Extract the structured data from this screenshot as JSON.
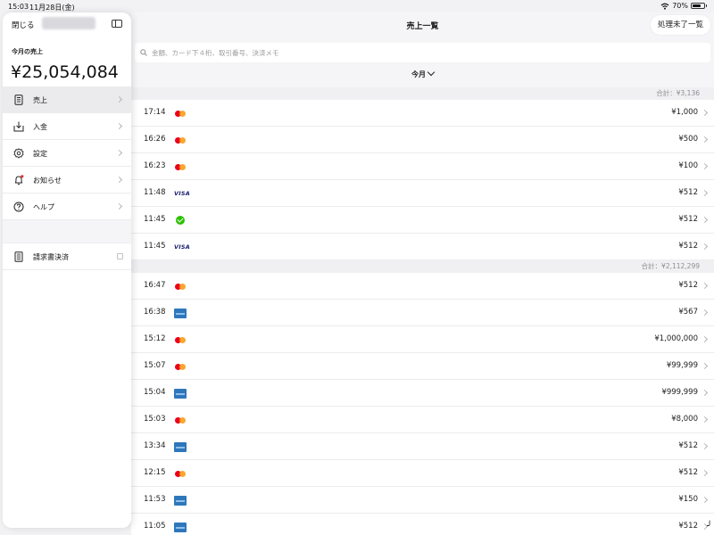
{
  "status_bar": {
    "time": "15:03",
    "date": "11月28日(金)",
    "battery": "70%",
    "battery_level": 0.7
  },
  "sidebar": {
    "close_label": "閉じる",
    "sales_label": "今月の売上",
    "sales_total": "¥25,054,084",
    "items": [
      {
        "label": "売上",
        "icon": "receipt-icon",
        "active": true
      },
      {
        "label": "入金",
        "icon": "deposit-tray-icon"
      },
      {
        "label": "設定",
        "icon": "gear-icon"
      },
      {
        "label": "お知らせ",
        "icon": "bell-icon",
        "badge_color": "#e5302c"
      },
      {
        "label": "ヘルプ",
        "icon": "question-circle-icon"
      }
    ],
    "invoice_label": "請求書決済"
  },
  "header": {
    "title": "売上一覧",
    "pending_button": "処理未了一覧"
  },
  "search": {
    "placeholder": "金額、カード下４桁、取引番号、決済メモ"
  },
  "period": {
    "label": "今月"
  },
  "groups": [
    {
      "total": "合計：¥3,136",
      "rows": [
        {
          "time": "17:14",
          "brand": "mastercard",
          "amount": "¥1,000"
        },
        {
          "time": "16:26",
          "brand": "mastercard",
          "amount": "¥500"
        },
        {
          "time": "16:23",
          "brand": "mastercard",
          "amount": "¥100"
        },
        {
          "time": "11:48",
          "brand": "visa",
          "amount": "¥512"
        },
        {
          "time": "11:45",
          "brand": "wechat",
          "amount": "¥512"
        },
        {
          "time": "11:45",
          "brand": "visa",
          "amount": "¥512"
        }
      ]
    },
    {
      "total": "合計：¥2,112,299",
      "rows": [
        {
          "time": "16:47",
          "brand": "mastercard",
          "amount": "¥512"
        },
        {
          "time": "16:38",
          "brand": "amex",
          "amount": "¥567"
        },
        {
          "time": "15:12",
          "brand": "mastercard",
          "amount": "¥1,000,000"
        },
        {
          "time": "15:07",
          "brand": "mastercard",
          "amount": "¥99,999"
        },
        {
          "time": "15:04",
          "brand": "amex",
          "amount": "¥999,999"
        },
        {
          "time": "15:03",
          "brand": "mastercard",
          "amount": "¥8,000"
        },
        {
          "time": "13:34",
          "brand": "amex",
          "amount": "¥512"
        },
        {
          "time": "12:15",
          "brand": "mastercard",
          "amount": "¥512"
        },
        {
          "time": "11:53",
          "brand": "amex",
          "amount": "¥150"
        },
        {
          "time": "11:05",
          "brand": "amex",
          "amount": "¥512"
        }
      ]
    }
  ],
  "brand_labels": {
    "visa": "VISA"
  }
}
